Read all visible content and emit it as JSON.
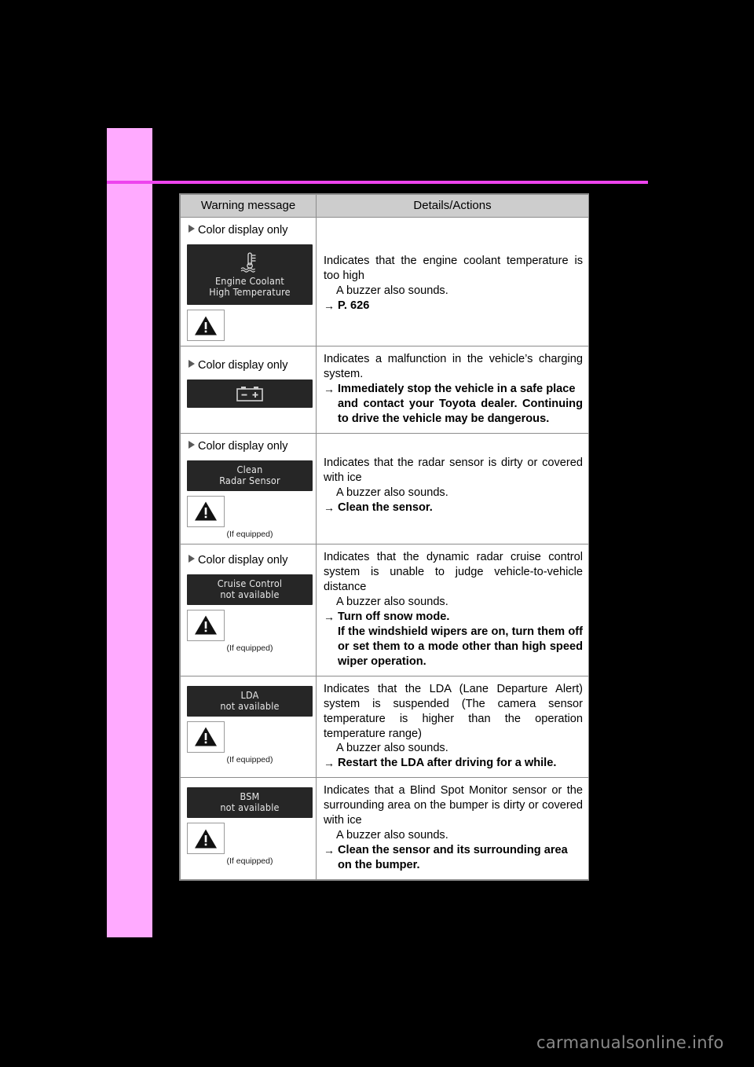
{
  "page": {
    "background_color": "#000000",
    "side_tab_color": "#ffaaff",
    "rule_color": "#ee44ee",
    "watermark": "carmanualsonline.info"
  },
  "table": {
    "headers": [
      "Warning message",
      "Details/Actions"
    ],
    "color_display_only_label": "Color display only",
    "if_equipped_label": "(If equipped)",
    "rows": [
      {
        "id": "engine-coolant-high-temperature",
        "color_display_only": true,
        "display": {
          "glyph": "coolant-temp-icon",
          "lines": [
            "Engine Coolant",
            "High Temperature"
          ]
        },
        "warning_triangle": true,
        "if_equipped": false,
        "details": {
          "intro": "Indicates that the engine coolant temperature is too high",
          "buzzer": "A buzzer also sounds.",
          "action": "P. 626",
          "action_bold": true,
          "continued": ""
        }
      },
      {
        "id": "charging-system-malfunction",
        "color_display_only": true,
        "display": {
          "glyph": "battery-icon",
          "lines": []
        },
        "warning_triangle": false,
        "if_equipped": false,
        "details": {
          "intro": "Indicates a malfunction in the vehicle’s charging system.",
          "buzzer": "",
          "action": "Immediately stop the vehicle in a safe place",
          "action_bold": true,
          "continued": "and contact your Toyota dealer. Continuing to drive the vehicle may be dangerous."
        }
      },
      {
        "id": "clean-radar-sensor",
        "color_display_only": true,
        "display": {
          "glyph": "",
          "lines": [
            "Clean",
            "Radar Sensor"
          ]
        },
        "warning_triangle": true,
        "if_equipped": true,
        "details": {
          "intro": "Indicates that the radar sensor is dirty or covered with ice",
          "buzzer": "A buzzer also sounds.",
          "action": "Clean the sensor.",
          "action_bold": true,
          "continued": ""
        }
      },
      {
        "id": "cruise-control-not-available",
        "color_display_only": true,
        "display": {
          "glyph": "",
          "lines": [
            "Cruise Control",
            "not available"
          ]
        },
        "warning_triangle": true,
        "if_equipped": true,
        "details": {
          "intro": "Indicates that the dynamic radar cruise control system is unable to judge vehicle-to-vehicle distance",
          "buzzer": "A buzzer also sounds.",
          "action": "Turn off snow mode.",
          "action_bold": true,
          "continued": "If the windshield wipers are on, turn them off or set them to a mode other than high speed wiper operation."
        }
      },
      {
        "id": "lda-not-available",
        "color_display_only": false,
        "display": {
          "glyph": "",
          "lines": [
            "LDA",
            "not available"
          ]
        },
        "warning_triangle": true,
        "if_equipped": true,
        "details": {
          "intro": "Indicates that the LDA (Lane Departure Alert) system is suspended (The camera sensor temperature is higher than the operation temperature range)",
          "buzzer": "A buzzer also sounds.",
          "action": "Restart the LDA after driving for a while.",
          "action_bold": true,
          "continued": ""
        }
      },
      {
        "id": "bsm-not-available",
        "color_display_only": false,
        "display": {
          "glyph": "",
          "lines": [
            "BSM",
            "not available"
          ]
        },
        "warning_triangle": true,
        "if_equipped": true,
        "details": {
          "intro": "Indicates that a Blind Spot Monitor sensor or the surrounding area on the bumper is dirty or covered with ice",
          "buzzer": "A buzzer also sounds.",
          "action": "Clean the sensor and its surrounding area",
          "action_bold": true,
          "continued": "on the bumper."
        }
      }
    ]
  }
}
